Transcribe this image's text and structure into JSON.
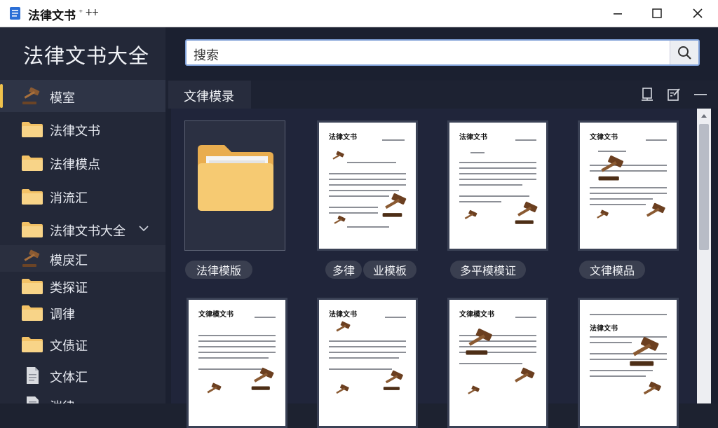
{
  "window": {
    "title": "法律文书",
    "title_suffix": "⁺ ⵜⵜ",
    "minimize": "—",
    "maximize": "☐",
    "close": "✕"
  },
  "sidebar": {
    "app_name": "法律文书大全",
    "items": [
      {
        "label": "模室",
        "icon": "gavel-icon",
        "active": true
      },
      {
        "label": "法律文书",
        "icon": "folder-icon"
      },
      {
        "label": "法律模点",
        "icon": "folder-icon"
      },
      {
        "label": "消流汇",
        "icon": "folder-icon"
      },
      {
        "label": "法律文书大全",
        "icon": "folder-icon",
        "expandable": true
      },
      {
        "label": "模戾汇",
        "icon": "gavel-icon",
        "sub": true
      },
      {
        "label": "类探证",
        "icon": "folder-icon"
      },
      {
        "label": "调律",
        "icon": "folder-icon"
      },
      {
        "label": "文债证",
        "icon": "folder-icon"
      },
      {
        "label": "文体汇",
        "icon": "document-icon"
      },
      {
        "label": "湍律",
        "icon": "document-icon"
      }
    ]
  },
  "search": {
    "placeholder": "搜索"
  },
  "tabs": {
    "active": "文律模录"
  },
  "cards": [
    {
      "label": "法律模版",
      "kind": "folder"
    },
    {
      "label": "多律",
      "label2": "业模板",
      "kind": "doc",
      "doc_title": "法律文书"
    },
    {
      "label": "多平模模证",
      "kind": "doc",
      "doc_title": "法律文书"
    },
    {
      "label": "文律模品",
      "kind": "doc",
      "doc_title": "文律文书"
    },
    {
      "label": "",
      "kind": "doc",
      "doc_title": "文律模文书"
    },
    {
      "label": "",
      "kind": "doc",
      "doc_title": "法律文书"
    },
    {
      "label": "",
      "kind": "doc",
      "doc_title": "文律模文书"
    },
    {
      "label": "",
      "kind": "doc",
      "doc_title": "法律文书"
    }
  ],
  "colors": {
    "accent": "#f0c24c",
    "sidebar": "#232838",
    "main": "#1b2030",
    "search_border": "#7fa0d8"
  }
}
